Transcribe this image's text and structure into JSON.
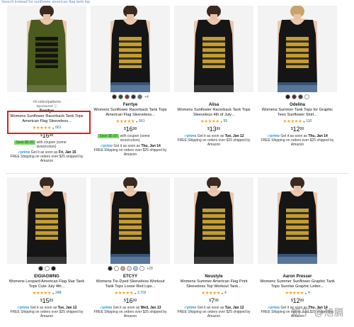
{
  "top_link": "Search instead for sunflower american flag tank top",
  "products": [
    {
      "colors_text": "+8 colors/patterns",
      "sponsored": "Sponsored ⓘ",
      "brand": "Ferrtye",
      "title": "Womens Sunflower Racerback Tank Tops American Flag Sleeveless...",
      "stars": "★★★★★",
      "count": "661",
      "price_whole": "16",
      "price_cents": "98",
      "coupon_badge": "Save $5.00",
      "coupon_text": "with coupon (some sizes/colors)",
      "prime": "prime",
      "delivery": "Get it as soon as",
      "delivery_date": "Fri, Jan 15",
      "free_ship": "FREE Shipping on orders over $25 shipped by Amazon",
      "swatches": [],
      "shirt_color": "#4b5a1d"
    },
    {
      "swatch_more": "+4",
      "brand": "Ferrtye",
      "title": "Womens Sunflower Racerback Tank Tops American Flag Sleeveless...",
      "stars": "★★★★★",
      "count": "661",
      "price_whole": "16",
      "price_cents": "98",
      "coupon_badge": "Save $5.00",
      "coupon_text": "with coupon (some sizes/colors)",
      "prime": "prime",
      "delivery": "Get it as soon as",
      "delivery_date": "Thu, Jan 14",
      "free_ship": "FREE Shipping on orders over $25 shipped by Amazon",
      "swatches": [
        "#222222",
        "#3a4a2a",
        "#8b2a3a",
        "#1f2d5a",
        "#6a6a6a"
      ],
      "shirt_color": "#151515"
    },
    {
      "brand": "Alisa",
      "title": "Womens Sunflower Racerback Tank Tops Sleeveless 4th of July...",
      "stars": "★★★★★",
      "count": "55",
      "price_whole": "13",
      "price_cents": "99",
      "prime": "prime",
      "delivery": "Get it as soon as",
      "delivery_date": "Tue, Jan 12",
      "free_ship": "FREE Shipping on orders over $25 shipped by Amazon",
      "swatches": [],
      "shirt_color": "#151515"
    },
    {
      "brand": "Odelina",
      "title": "Womens Summer Tank Tops for Graphic Tees Sunflower Shirt...",
      "stars": "★★★★★",
      "count": "110",
      "price_whole": "12",
      "price_cents": "99",
      "prime": "prime",
      "delivery": "Get it as soon as",
      "delivery_date": "Thu, Jan 14",
      "free_ship": "FREE Shipping on orders over $25 shipped by Amazon",
      "swatches": [
        "#1a1a1a",
        "#6b1f2a",
        "#3a3a3a",
        "#ffffff"
      ],
      "shirt_color": "#151515"
    },
    {
      "brand": "EIGIAGWNG",
      "title": "Womens Leopard American Flag Star Tank Tops Cute July 4th...",
      "stars": "★★★★★",
      "count": "248",
      "price_whole": "15",
      "price_cents": "99",
      "prime": "prime",
      "delivery": "Get it as soon as",
      "delivery_date": "Tue, Jan 12",
      "free_ship": "FREE Shipping on orders over $25 shipped by Amazon",
      "swatches": [
        "#1a1a1a",
        "#ffffff",
        "#1a1a1a"
      ],
      "shirt_color": "#151515"
    },
    {
      "brand": "ETCYY",
      "swatch_more": "+28",
      "title": "Womens Tie-Dyed Sleeveless Workout Tank Tops Loose Red Lips...",
      "stars": "★★★★★",
      "count": "2,702",
      "price_whole": "16",
      "price_cents": "99",
      "prime": "prime",
      "delivery": "Get it as soon as",
      "delivery_date": "Wed, Jan 13",
      "free_ship": "FREE Shipping on orders over $25 shipped by Amazon",
      "swatches": [
        "#1a1a1a",
        "#ffffff",
        "#c7a46a",
        "#e0e0e0",
        "#a9c4e4",
        "#ffffff"
      ],
      "shirt_color": "#151515"
    },
    {
      "brand": "Noustyle",
      "title": "Womens Summer American Flag Print Sleeveless Top Workout Tank...",
      "stars": "★★★★★",
      "count": "4",
      "price_whole": "7",
      "price_cents": "99",
      "prime": "prime",
      "delivery": "Get it as soon as",
      "delivery_date": "Tue, Jan 12",
      "free_ship": "FREE Shipping on orders over $25 shipped by Amazon",
      "swatches": [],
      "shirt_color": "#151515"
    },
    {
      "brand": "Aaron Presser",
      "title": "Womens Summer Sunflower Graphic Tank Tops Sunrise Graphic Letter...",
      "stars": "★★★★★",
      "count": "4",
      "price_whole": "12",
      "price_cents": "99",
      "prime": "prime",
      "delivery": "Get it as soon as",
      "delivery_date": "Thu, Jan 14",
      "free_ship": "FREE Shipping on orders over $25 shipped by Amazon",
      "swatches": [],
      "shirt_color": "#151515"
    }
  ],
  "watermark": "知乎 @旭膈",
  "colors": {
    "accent_star": "#f5a623",
    "prime_blue": "#1a98d5",
    "coupon_green": "#7fda69",
    "highlight_red": "#d9231d",
    "link": "#007185"
  }
}
